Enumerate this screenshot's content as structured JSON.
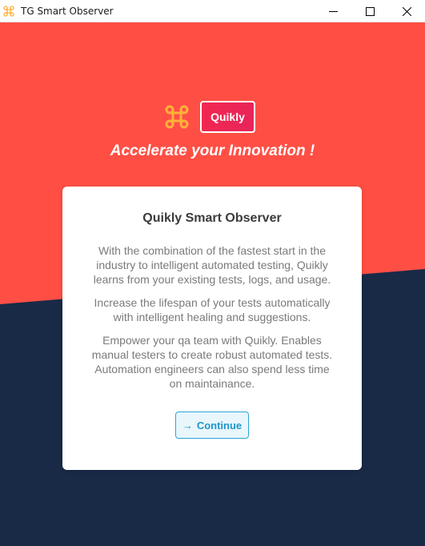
{
  "window": {
    "title": "TG Smart Observer",
    "controls": [
      "minimize",
      "maximize",
      "close"
    ]
  },
  "colors": {
    "header_red": "#ff4f45",
    "footer_navy": "#192a47",
    "badge_red": "#f02850",
    "accent_orange": "#ffb03a",
    "button_blue": "#1e97cc"
  },
  "header": {
    "logo_icon": "command-key-icon",
    "brand_badge": "Quikly",
    "tagline": "Accelerate your Innovation !"
  },
  "card": {
    "title": "Quikly Smart Observer",
    "paragraphs": [
      "With the combination of the fastest start in the industry to intelligent automated testing, Quikly learns from your existing tests, logs, and usage.",
      "Increase the lifespan of your tests automatically with intelligent healing and suggestions.",
      "Empower your qa team with Quikly. Enables manual testers to create robust automated tests. Automation engineers can also spend less time on maintainance."
    ],
    "continue": {
      "icon": "arrow-right-icon",
      "arrow_glyph": "→",
      "label": "Continue"
    }
  }
}
